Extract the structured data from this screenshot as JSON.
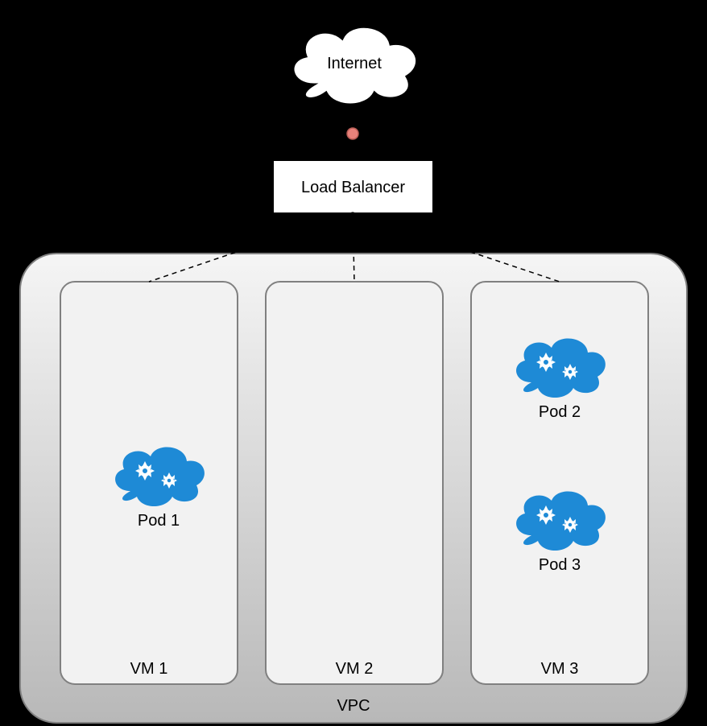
{
  "internet": {
    "label": "Internet"
  },
  "load_balancer": {
    "label": "Load Balancer"
  },
  "vpc": {
    "label": "VPC"
  },
  "vms": [
    {
      "label": "VM 1"
    },
    {
      "label": "VM 2"
    },
    {
      "label": "VM 3"
    }
  ],
  "pods": [
    {
      "label": "Pod 1"
    },
    {
      "label": "Pod 2"
    },
    {
      "label": "Pod 3"
    }
  ]
}
